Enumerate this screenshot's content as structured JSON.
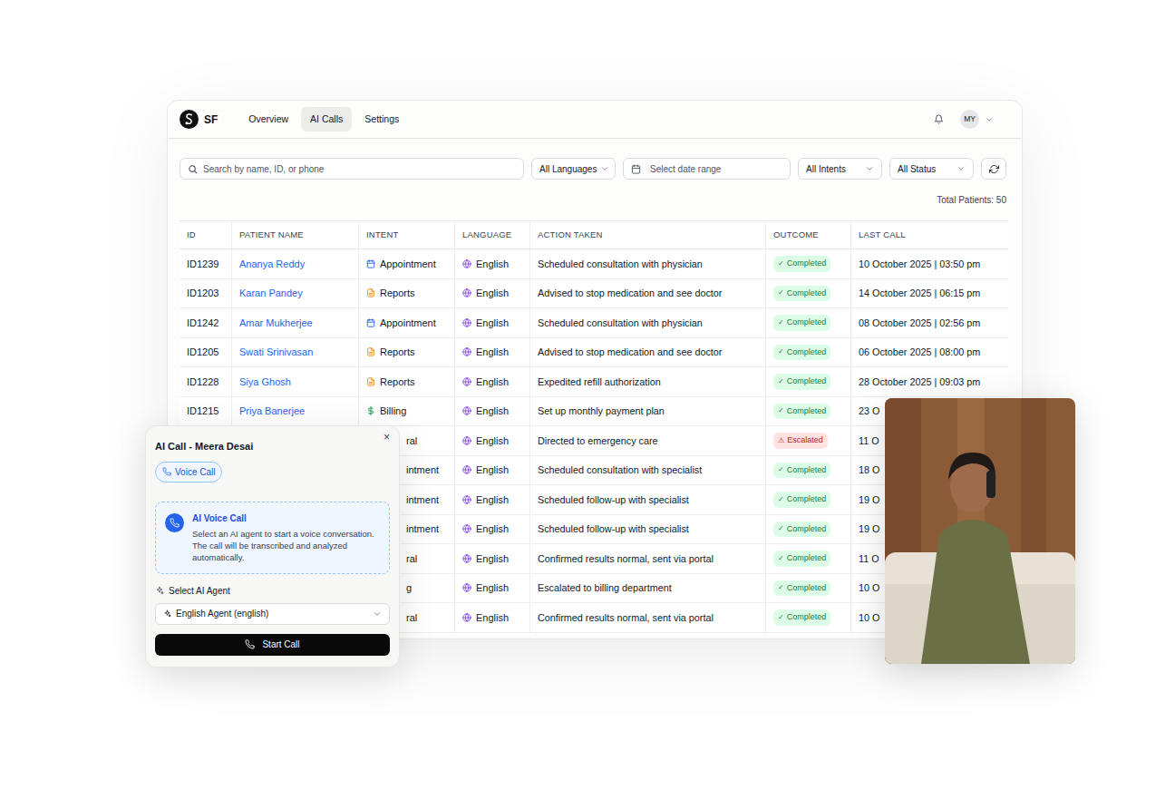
{
  "header": {
    "logo_text": "SF",
    "nav": [
      {
        "label": "Overview",
        "selected": false
      },
      {
        "label": "AI Calls",
        "selected": true
      },
      {
        "label": "Settings",
        "selected": false
      }
    ],
    "avatar": "MY"
  },
  "filters": {
    "search": {
      "placeholder": "Search by name, ID, or phone"
    },
    "language": "All Languages",
    "date": "Select date range",
    "intent": "All Intents",
    "status": "All Status"
  },
  "total": "Total Patients: 50",
  "table": {
    "columns": [
      "ID",
      "PATIENT NAME",
      "INTENT",
      "LANGUAGE",
      "ACTION TAKEN",
      "OUTCOME",
      "LAST CALL"
    ],
    "rows": [
      {
        "kind": "full",
        "id": "ID1239",
        "name": "Ananya Reddy",
        "intent": {
          "label": "Appointment",
          "kind": "appointment"
        },
        "language": "English",
        "action": "Scheduled consultation with physician",
        "outcome": {
          "icon": "✓",
          "label": "Completed",
          "kind": "completed"
        },
        "last_call": "10 October 2025 | 03:50 pm"
      },
      {
        "kind": "full",
        "id": "ID1203",
        "name": "Karan Pandey",
        "intent": {
          "label": "Reports",
          "kind": "reports"
        },
        "language": "English",
        "action": "Advised to stop medication and see doctor",
        "outcome": {
          "icon": "✓",
          "label": "Completed",
          "kind": "completed"
        },
        "last_call": "14 October 2025 | 06:15 pm"
      },
      {
        "kind": "full",
        "id": "ID1242",
        "name": "Amar Mukherjee",
        "intent": {
          "label": "Appointment",
          "kind": "appointment"
        },
        "language": "English",
        "action": "Scheduled consultation with physician",
        "outcome": {
          "icon": "✓",
          "label": "Completed",
          "kind": "completed"
        },
        "last_call": "08 October 2025 | 02:56 pm"
      },
      {
        "kind": "full",
        "id": "ID1205",
        "name": "Swati Srinivasan",
        "intent": {
          "label": "Reports",
          "kind": "reports"
        },
        "language": "English",
        "action": "Advised to stop medication and see doctor",
        "outcome": {
          "icon": "✓",
          "label": "Completed",
          "kind": "completed"
        },
        "last_call": "06 October 2025 | 08:00 pm"
      },
      {
        "kind": "full",
        "id": "ID1228",
        "name": "Siya Ghosh",
        "intent": {
          "label": "Reports",
          "kind": "reports"
        },
        "language": "English",
        "action": "Expedited refill authorization",
        "outcome": {
          "icon": "✓",
          "label": "Completed",
          "kind": "completed"
        },
        "last_call": "28 October 2025 | 09:03 pm"
      },
      {
        "kind": "full",
        "id": "ID1215",
        "name": "Priya Banerjee",
        "intent": {
          "label": "Billing",
          "kind": "billing"
        },
        "language": "English",
        "action": "Set up monthly payment plan",
        "outcome": {
          "icon": "✓",
          "label": "Completed",
          "kind": "completed"
        },
        "last_call": "23 O"
      },
      {
        "kind": "covered",
        "intent": {
          "label": "ral"
        },
        "language": "English",
        "action": "Directed to emergency care",
        "outcome": {
          "icon": "⚠",
          "label": "Escalated",
          "kind": "escalated"
        },
        "last_call": "11 O"
      },
      {
        "kind": "covered",
        "intent": {
          "label": "intment"
        },
        "language": "English",
        "action": "Scheduled consultation with specialist",
        "outcome": {
          "icon": "✓",
          "label": "Completed",
          "kind": "completed"
        },
        "last_call": "18 O"
      },
      {
        "kind": "covered",
        "intent": {
          "label": "intment"
        },
        "language": "English",
        "action": "Scheduled follow-up with specialist",
        "outcome": {
          "icon": "✓",
          "label": "Completed",
          "kind": "completed"
        },
        "last_call": "19 O"
      },
      {
        "kind": "covered",
        "intent": {
          "label": "intment"
        },
        "language": "English",
        "action": "Scheduled follow-up with specialist",
        "outcome": {
          "icon": "✓",
          "label": "Completed",
          "kind": "completed"
        },
        "last_call": "19 O"
      },
      {
        "kind": "covered",
        "intent": {
          "label": "ral"
        },
        "language": "English",
        "action": "Confirmed results normal, sent via portal",
        "outcome": {
          "icon": "✓",
          "label": "Completed",
          "kind": "completed"
        },
        "last_call": "11 O"
      },
      {
        "kind": "covered",
        "intent": {
          "label": "g"
        },
        "language": "English",
        "action": "Escalated to billing department",
        "outcome": {
          "icon": "✓",
          "label": "Completed",
          "kind": "completed"
        },
        "last_call": "10 O"
      },
      {
        "kind": "covered",
        "intent": {
          "label": "ral"
        },
        "language": "English",
        "action": "Confirmed results normal, sent via portal",
        "outcome": {
          "icon": "✓",
          "label": "Completed",
          "kind": "completed"
        },
        "last_call": "10 O"
      }
    ]
  },
  "call_panel": {
    "title": "AI Call - Meera Desai",
    "close": "×",
    "mode": {
      "label": "Voice Call",
      "selected": true
    },
    "info": {
      "title": "AI Voice Call",
      "text": "Select an AI agent to start a voice conversation. The call will be transcribed and analyzed automatically."
    },
    "agent_label": "Select AI Agent",
    "agent": "English Agent (english)",
    "button": "Start Call"
  }
}
